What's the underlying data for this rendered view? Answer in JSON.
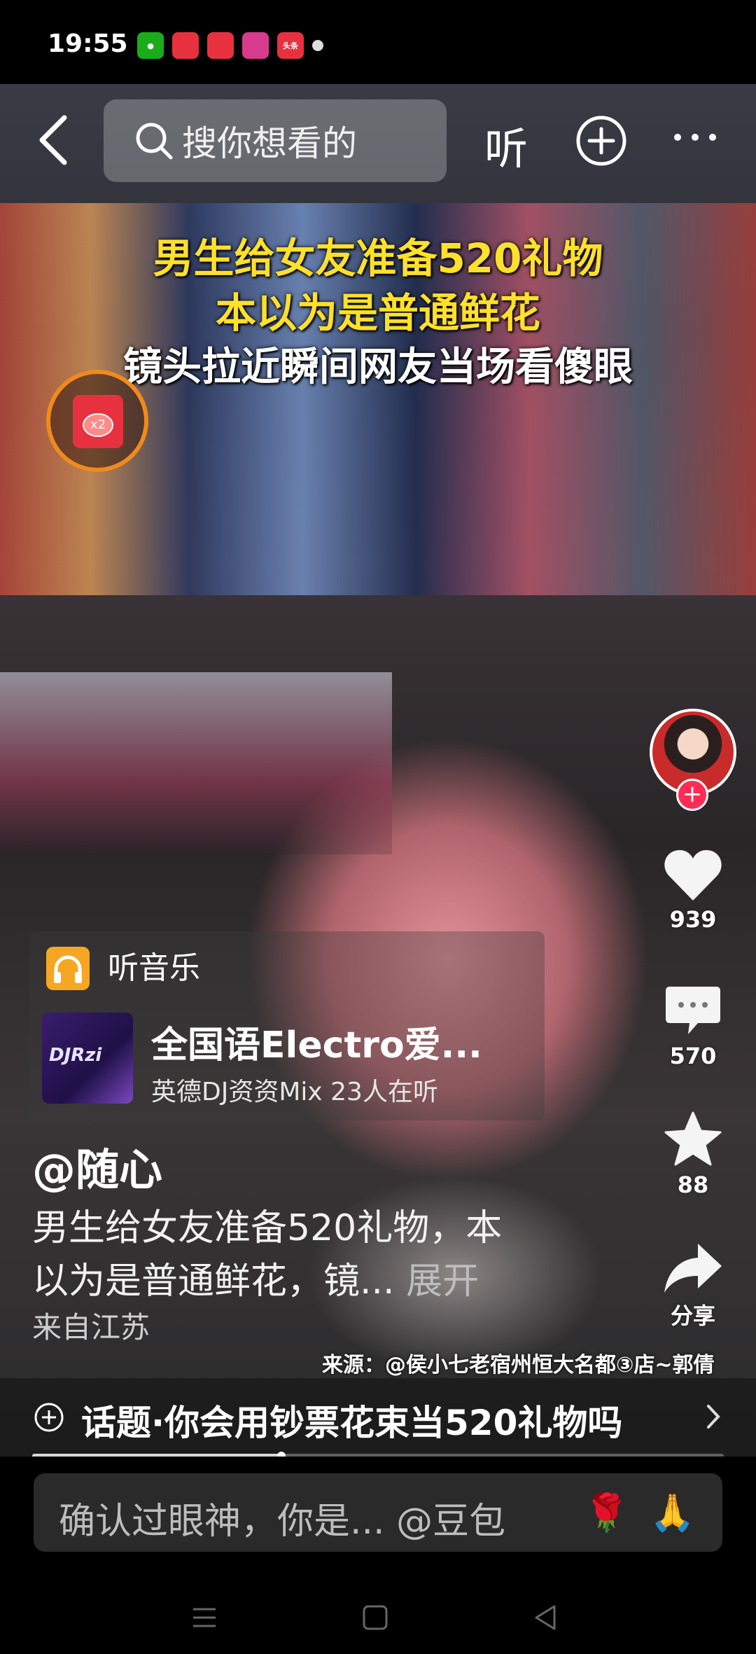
{
  "status_bar": {
    "time": "19:55",
    "app_icons": [
      {
        "name": "wechat-icon",
        "color": "#1aad19"
      },
      {
        "name": "app-icon-2",
        "color": "#e8313f"
      },
      {
        "name": "app-icon-3",
        "color": "#e8313f"
      },
      {
        "name": "app-icon-4",
        "color": "#d83a8e"
      },
      {
        "name": "toutiao-icon",
        "color": "#e8313f",
        "label": "头条"
      }
    ]
  },
  "top_bar": {
    "search_placeholder": "搜你想看的",
    "listen_label": "听"
  },
  "video": {
    "caption_lines": [
      "男生给女友准备520礼物",
      "本以为是普通鲜花",
      "镜头拉近瞬间网友当场看傻眼"
    ],
    "redpacket_badge": "x2",
    "source_watermark": "来源：@侯小七老宿州恒大名都③店~郭倩"
  },
  "actions": {
    "like_count": "939",
    "comment_count": "570",
    "favorite_count": "88",
    "share_label": "分享"
  },
  "music": {
    "label": "听音乐",
    "cover_text": "DJRzi",
    "title": "全国语Electro爱...",
    "subtitle": "英德DJ资资Mix 23人在听"
  },
  "post": {
    "author": "@随心",
    "description_line1": "男生给女友准备520礼物，本",
    "description_line2": "以为是普通鲜花，镜...",
    "expand_label": "展开",
    "location": "来自江苏"
  },
  "topic": {
    "text": "话题·你会用钞票花束当520礼物吗"
  },
  "playback": {
    "progress": 0.36
  },
  "comment_input": {
    "placeholder": "确认过眼神，你是... @豆包",
    "emoji_1": "🌹",
    "emoji_2": "🙏"
  }
}
